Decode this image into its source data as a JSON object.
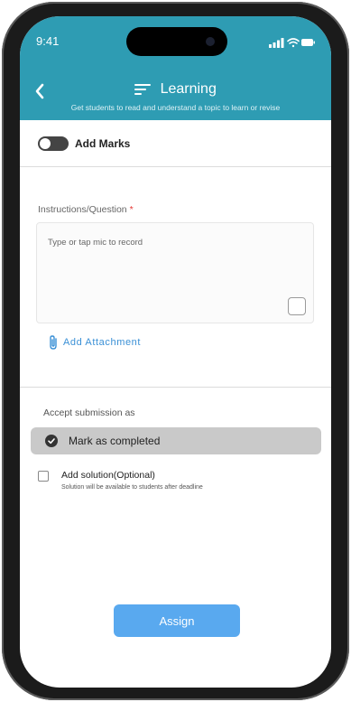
{
  "status_bar": {
    "time": "9:41",
    "icons": [
      "signal-icon",
      "wifi-icon",
      "battery-icon"
    ]
  },
  "header": {
    "back_icon": "chevron-left-icon",
    "title_icon": "menu-lines-icon",
    "title": "Learning",
    "subtitle": "Get students to read and understand a topic to learn or revise",
    "color": "#2e9cb3"
  },
  "marks": {
    "label": "Add Marks",
    "enabled": false
  },
  "instructions": {
    "label": "Instructions/Question",
    "required_mark": "*",
    "placeholder": "Type or tap mic to record",
    "attachment_label": "Add Attachment",
    "attachment_icon": "paperclip-icon"
  },
  "submission": {
    "label": "Accept submission as",
    "selected_option": "Mark as completed",
    "solution_title": "Add solution(Optional)",
    "solution_subtitle": "Solution will be available to students after deadline",
    "solution_checked": false
  },
  "actions": {
    "assign_label": "Assign",
    "assign_color": "#59a9ef"
  }
}
